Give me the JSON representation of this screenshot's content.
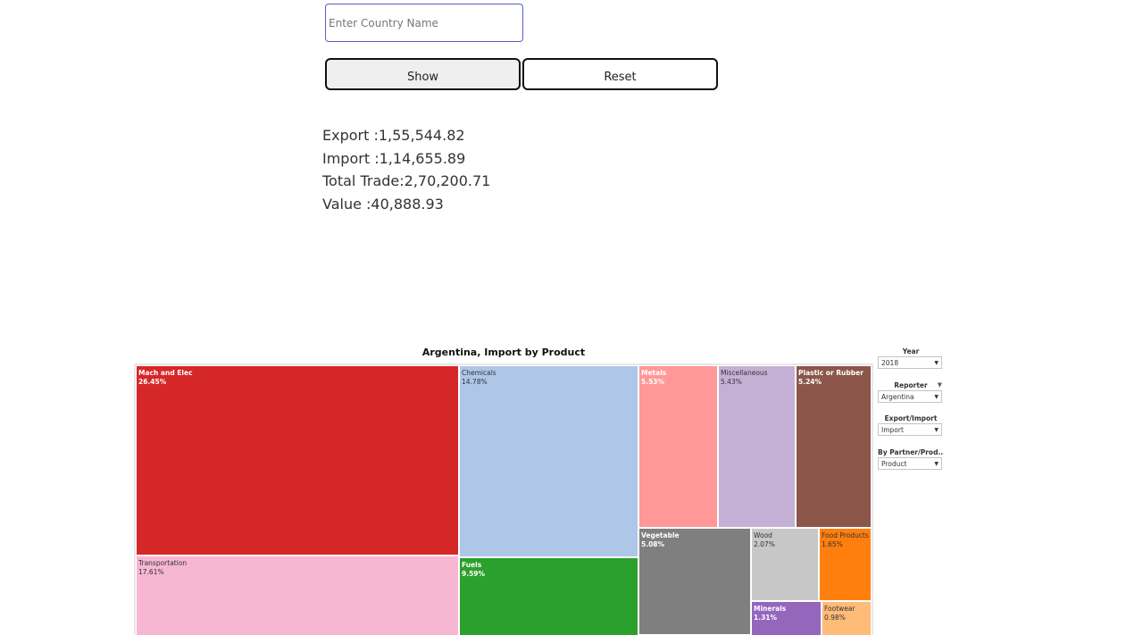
{
  "form": {
    "country_placeholder": "Enter Country Name",
    "show_label": "Show",
    "reset_label": "Reset"
  },
  "stats": {
    "export": "Export :1,55,544.82",
    "import": "Import :1,14,655.89",
    "total": "Total Trade:2,70,200.71",
    "value": "Value :40,888.93"
  },
  "viz": {
    "title": "Argentina, Import by Product"
  },
  "chart_data": {
    "type": "treemap",
    "title": "Argentina, Import by Product",
    "items": [
      {
        "name": "Mach and Elec",
        "pct": "26.45%",
        "color": "#d62728"
      },
      {
        "name": "Transportation",
        "pct": "17.61%",
        "color": "#f7b6d2"
      },
      {
        "name": "Chemicals",
        "pct": "14.78%",
        "color": "#aec7e8"
      },
      {
        "name": "Fuels",
        "pct": "9.59%",
        "color": "#2ca02c"
      },
      {
        "name": "Metals",
        "pct": "5.53%",
        "color": "#ff9896"
      },
      {
        "name": "Miscellaneous",
        "pct": "5.43%",
        "color": "#c5b0d5"
      },
      {
        "name": "Plastic or Rubber",
        "pct": "5.24%",
        "color": "#8c564b"
      },
      {
        "name": "Vegetable",
        "pct": "5.08%",
        "color": "#7f7f7f"
      },
      {
        "name": "Wood",
        "pct": "2.07%",
        "color": "#c7c7c7"
      },
      {
        "name": "Food Products",
        "pct": "1.65%",
        "color": "#ff7f0e"
      },
      {
        "name": "Minerals",
        "pct": "1.31%",
        "color": "#9467bd"
      },
      {
        "name": "Footwear",
        "pct": "0.98%",
        "color": "#ffbb78"
      }
    ]
  },
  "filters": {
    "year": {
      "label": "Year",
      "value": "2018"
    },
    "reporter": {
      "label": "Reporter",
      "value": "Argentina"
    },
    "export_import": {
      "label": "Export/Import",
      "value": "Import"
    },
    "by": {
      "label": "By Partner/Prod...",
      "value": "Product"
    }
  }
}
